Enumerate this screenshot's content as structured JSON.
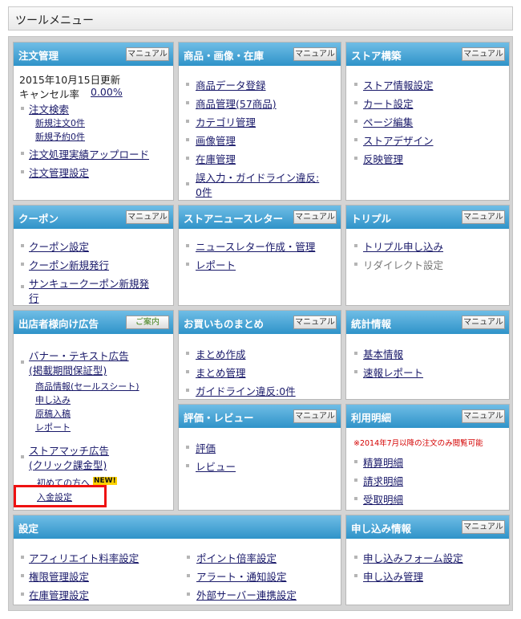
{
  "page": {
    "title": "ツールメニュー"
  },
  "panels": {
    "order": {
      "title": "注文管理",
      "button": "マニュアル",
      "updated": "2015年10月15日更新",
      "cancel_label": "キャンセル率",
      "cancel_rate": "0.00%",
      "search": "注文検索",
      "new_orders": "新規注文0件",
      "new_reservations": "新規予約0件",
      "upload": "注文処理実績アップロード",
      "settings": "注文管理設定"
    },
    "product": {
      "title": "商品・画像・在庫",
      "button": "マニュアル",
      "items": [
        "商品データ登録",
        "商品管理(57商品)",
        "カテゴリ管理",
        "画像管理",
        "在庫管理"
      ],
      "violation_line1": "誤入力・ガイドライン違反:",
      "violation_line2": "0件"
    },
    "store": {
      "title": "ストア構築",
      "button": "マニュアル",
      "items": [
        "ストア情報設定",
        "カート設定",
        "ページ編集",
        "ストアデザイン",
        "反映管理"
      ]
    },
    "coupon": {
      "title": "クーポン",
      "button": "マニュアル",
      "items": [
        "クーポン設定",
        "クーポン新規発行"
      ],
      "thankyou_line1": "サンキュークーポン新規発",
      "thankyou_line2": "行"
    },
    "newsletter": {
      "title": "ストアニュースレター",
      "button": "マニュアル",
      "items": [
        "ニュースレター作成・管理",
        "レポート"
      ]
    },
    "triple": {
      "title": "トリプル",
      "button": "マニュアル",
      "apply": "トリプル申し込み",
      "redirect": "リダイレクト設定"
    },
    "ads": {
      "title": "出店者様向け広告",
      "button": "ご案内",
      "banner_line1": "バナー・テキスト広告",
      "banner_line2": "(掲載期間保証型)",
      "sub_items": [
        "商品情報(セールスシート)",
        "申し込み",
        "原稿入稿",
        "レポート"
      ],
      "match_line1": "ストアマッチ広告",
      "match_line2": "(クリック課金型)",
      "first_time": "初めての方へ",
      "new_badge": "NEW!",
      "deposit": "入金設定"
    },
    "matome": {
      "title": "お買いものまとめ",
      "button": "マニュアル",
      "items": [
        "まとめ作成",
        "まとめ管理",
        "ガイドライン違反:0件"
      ]
    },
    "stats": {
      "title": "統計情報",
      "button": "マニュアル",
      "items": [
        "基本情報",
        "速報レポート"
      ]
    },
    "review": {
      "title": "評価・レビュー",
      "button": "マニュアル",
      "items": [
        "評価",
        "レビュー"
      ]
    },
    "usage": {
      "title": "利用明細",
      "button": "マニュアル",
      "note": "※2014年7月以降の注文のみ閲覧可能",
      "items": [
        "精算明細",
        "請求明細",
        "受取明細"
      ]
    },
    "settings": {
      "title": "設定",
      "col1": [
        "アフィリエイト料率設定",
        "権限管理設定",
        "在庫管理設定"
      ],
      "col2": [
        "ポイント倍率設定",
        "アラート・通知設定",
        "外部サーバー連携設定"
      ]
    },
    "application": {
      "title": "申し込み情報",
      "button": "マニュアル",
      "items": [
        "申し込みフォーム設定",
        "申し込み管理"
      ]
    }
  },
  "colors": {
    "header": "#2f93c9",
    "link": "#1a1a6a",
    "highlight": "#ee1111",
    "note": "#d40000"
  }
}
